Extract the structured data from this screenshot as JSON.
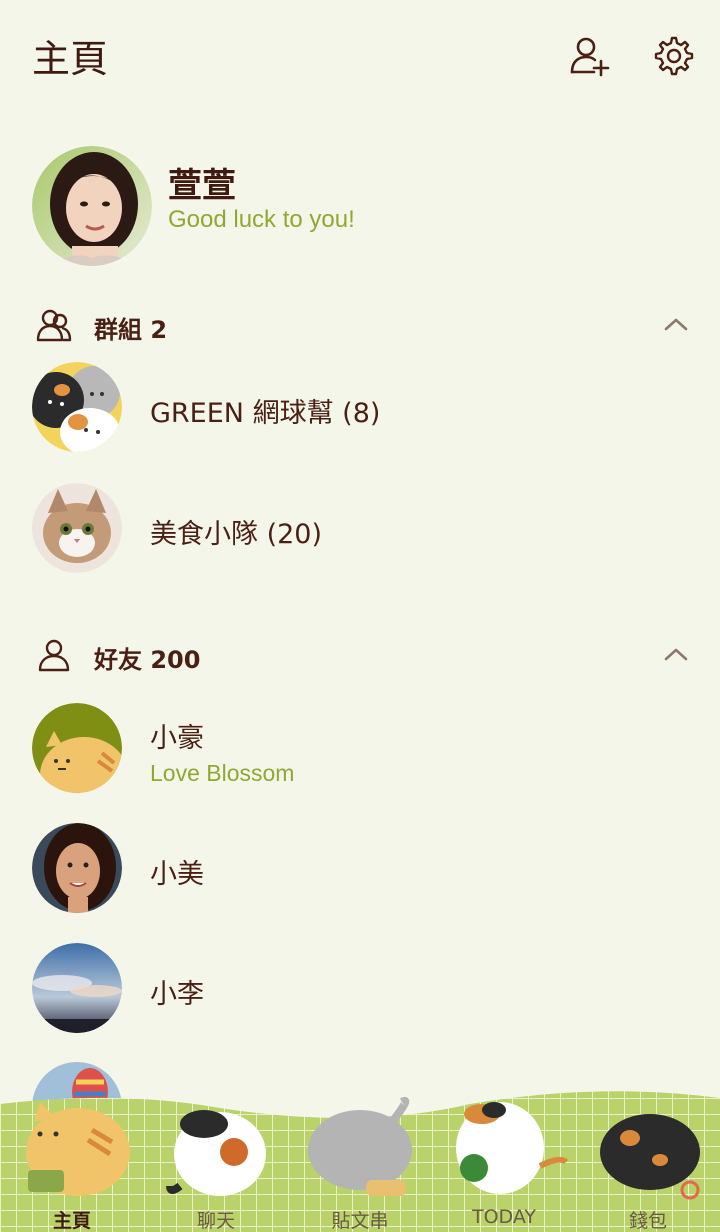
{
  "header": {
    "title": "主頁",
    "add_friend_icon": "add-friend-icon",
    "settings_icon": "gear-icon"
  },
  "profile": {
    "name": "萱萱",
    "status": "Good luck to you!"
  },
  "groups": {
    "label": "群組 2",
    "items": [
      {
        "name": "GREEN 網球幫 (8)"
      },
      {
        "name": "美食小隊 (20)"
      }
    ]
  },
  "friends": {
    "label": "好友 200",
    "items": [
      {
        "name": "小豪",
        "status": "Love Blossom"
      },
      {
        "name": "小美",
        "status": ""
      },
      {
        "name": "小李",
        "status": ""
      }
    ]
  },
  "tabs": [
    {
      "label": "主頁",
      "active": true
    },
    {
      "label": "聊天",
      "active": false
    },
    {
      "label": "貼文串",
      "active": false
    },
    {
      "label": "TODAY",
      "active": false
    },
    {
      "label": "錢包",
      "active": false
    }
  ],
  "colors": {
    "background": "#f5f6ea",
    "text": "#4a1f14",
    "status": "#8fa832",
    "tabbar": "#b9d36a"
  }
}
